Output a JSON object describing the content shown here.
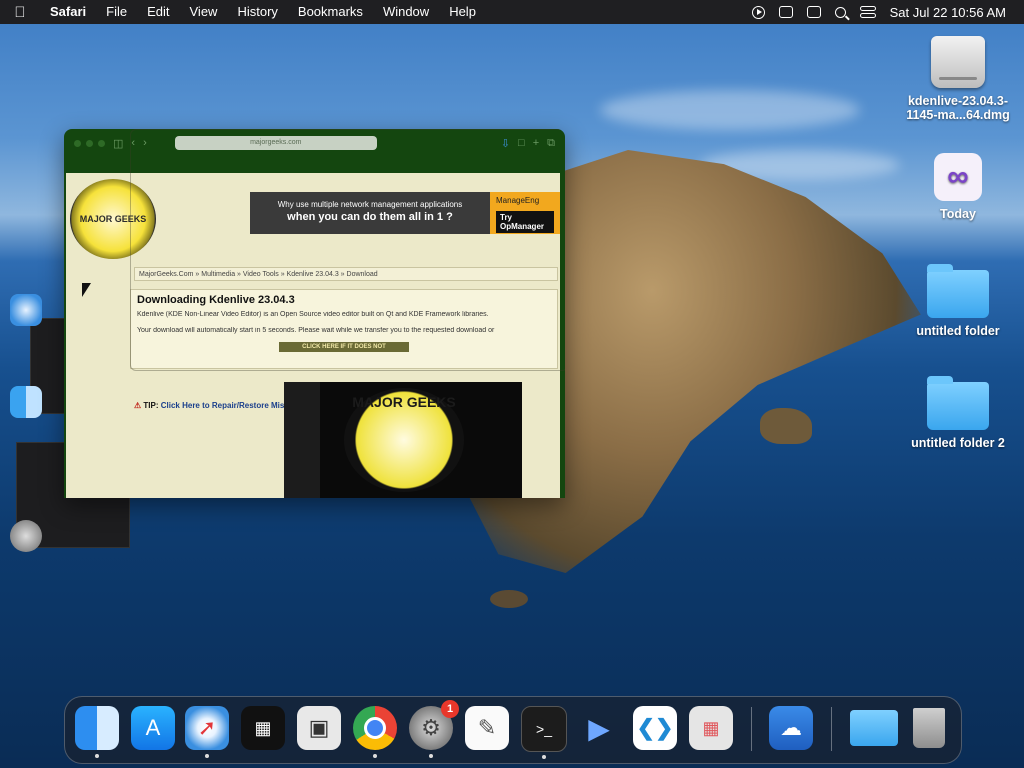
{
  "menubar": {
    "app": "Safari",
    "items": [
      "File",
      "Edit",
      "View",
      "History",
      "Bookmarks",
      "Window",
      "Help"
    ],
    "clock": "Sat Jul 22  10:56 AM"
  },
  "desktop": {
    "icons": [
      {
        "label": "kdenlive-23.04.3-1145-ma...64.dmg",
        "icon": "disk-image-icon"
      },
      {
        "label": "Today",
        "icon": "visual-studio-icon"
      },
      {
        "label": "untitled folder",
        "icon": "folder-icon"
      },
      {
        "label": "untitled folder 2",
        "icon": "folder-icon"
      }
    ]
  },
  "browser": {
    "url": "majorgeeks.com",
    "page": {
      "logo_text": "MAJOR GEEKS",
      "banner_line1": "Why use multiple network management applications",
      "banner_line2": "when you can do them all in 1 ?",
      "banner_brand": "ManageEng",
      "banner_cta": "Try OpManager",
      "breadcrumb": "MajorGeeks.Com » Multimedia » Video Tools » Kdenlive 23.04.3 » Download",
      "title": "Downloading Kdenlive 23.04.3",
      "description": "Kdenlive (KDE Non-Linear Video Editor) is an Open Source video editor built on Qt and KDE Framework libraries.",
      "wait_text": "Your download will automatically start in 5 seconds. Please wait while we transfer you to the requested download or",
      "click_here": "CLICK HERE IF IT DOES NOT",
      "tip_label": "TIP:",
      "tip_link": "Click Here to Repair/Restore Missing Windows OS Files Damaged by Malware",
      "video_logo": "MAJOR GEEKS"
    }
  },
  "dock": {
    "items": [
      {
        "name": "Finder",
        "icon": "finder-icon",
        "running": true
      },
      {
        "name": "App Store",
        "icon": "app-store-icon",
        "running": false
      },
      {
        "name": "Safari",
        "icon": "safari-icon",
        "running": true
      },
      {
        "name": "Sidebar app",
        "icon": "window-tiles-icon",
        "running": false
      },
      {
        "name": "Screenshot",
        "icon": "screenshot-icon",
        "running": false
      },
      {
        "name": "Google Chrome",
        "icon": "chrome-icon",
        "running": true
      },
      {
        "name": "System Settings",
        "icon": "settings-gear-icon",
        "running": true,
        "badge": "1"
      },
      {
        "name": "TextEdit",
        "icon": "notepad-icon",
        "running": false
      },
      {
        "name": "Terminal",
        "icon": "terminal-icon",
        "running": true
      },
      {
        "name": "Media Player",
        "icon": "media-player-icon",
        "running": false
      },
      {
        "name": "Visual Studio Code",
        "icon": "vscode-icon",
        "running": false
      },
      {
        "name": "Launchpad",
        "icon": "launchpad-icon",
        "running": false
      },
      {
        "name": "Weather",
        "icon": "weather-icon",
        "running": false
      },
      {
        "name": "Downloads",
        "icon": "folder-icon",
        "running": false
      },
      {
        "name": "Trash",
        "icon": "trash-icon",
        "running": false
      }
    ]
  },
  "colors": {
    "menubar": "#1f1f22",
    "window_chrome": "#14460f",
    "page_bg": "#ece9c9",
    "badge": "#e8372b"
  }
}
